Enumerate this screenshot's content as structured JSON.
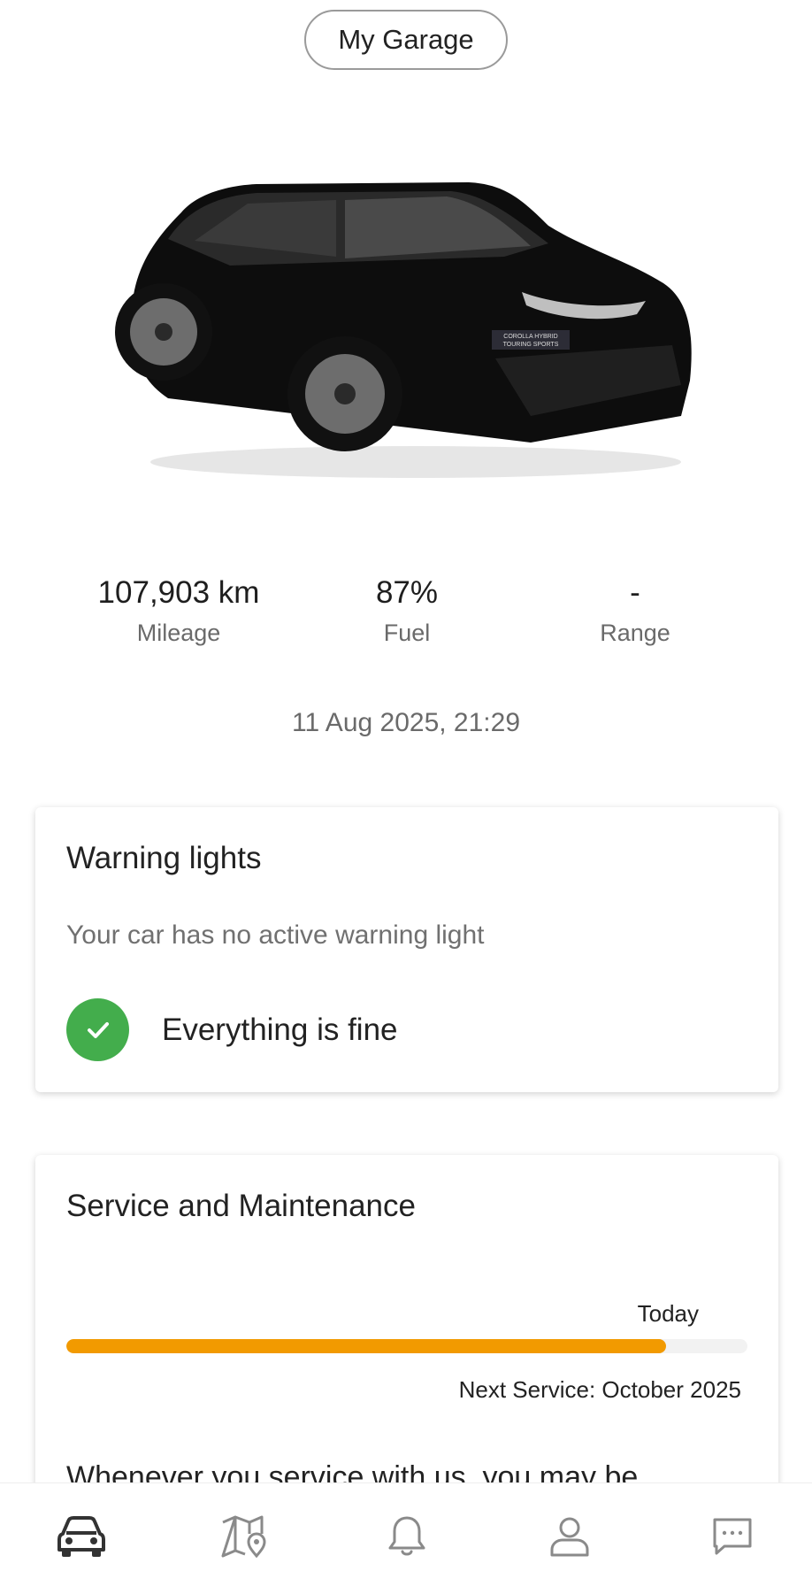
{
  "header": {
    "garage_label": "My Garage"
  },
  "vehicle": {
    "badge_line1": "COROLLA HYBRID",
    "badge_line2": "TOURING SPORTS"
  },
  "stats": [
    {
      "value": "107,903 km",
      "label": "Mileage"
    },
    {
      "value": "87%",
      "label": "Fuel"
    },
    {
      "value": "-",
      "label": "Range"
    }
  ],
  "updated_at": "11 Aug 2025, 21:29",
  "warning_card": {
    "title": "Warning lights",
    "description": "Your car has no active warning light",
    "status_text": "Everything is fine",
    "status_color": "#43ad4c"
  },
  "service_card": {
    "title": "Service and Maintenance",
    "today_label": "Today",
    "progress_fraction": 0.88,
    "progress_color": "#f29a00",
    "next_service": "Next Service: October 2025",
    "body_text": "Whenever you service with us, you may be"
  },
  "nav": [
    {
      "icon": "car-icon",
      "active": true
    },
    {
      "icon": "map-icon",
      "active": false
    },
    {
      "icon": "bell-icon",
      "active": false
    },
    {
      "icon": "profile-icon",
      "active": false
    },
    {
      "icon": "chat-icon",
      "active": false
    }
  ]
}
